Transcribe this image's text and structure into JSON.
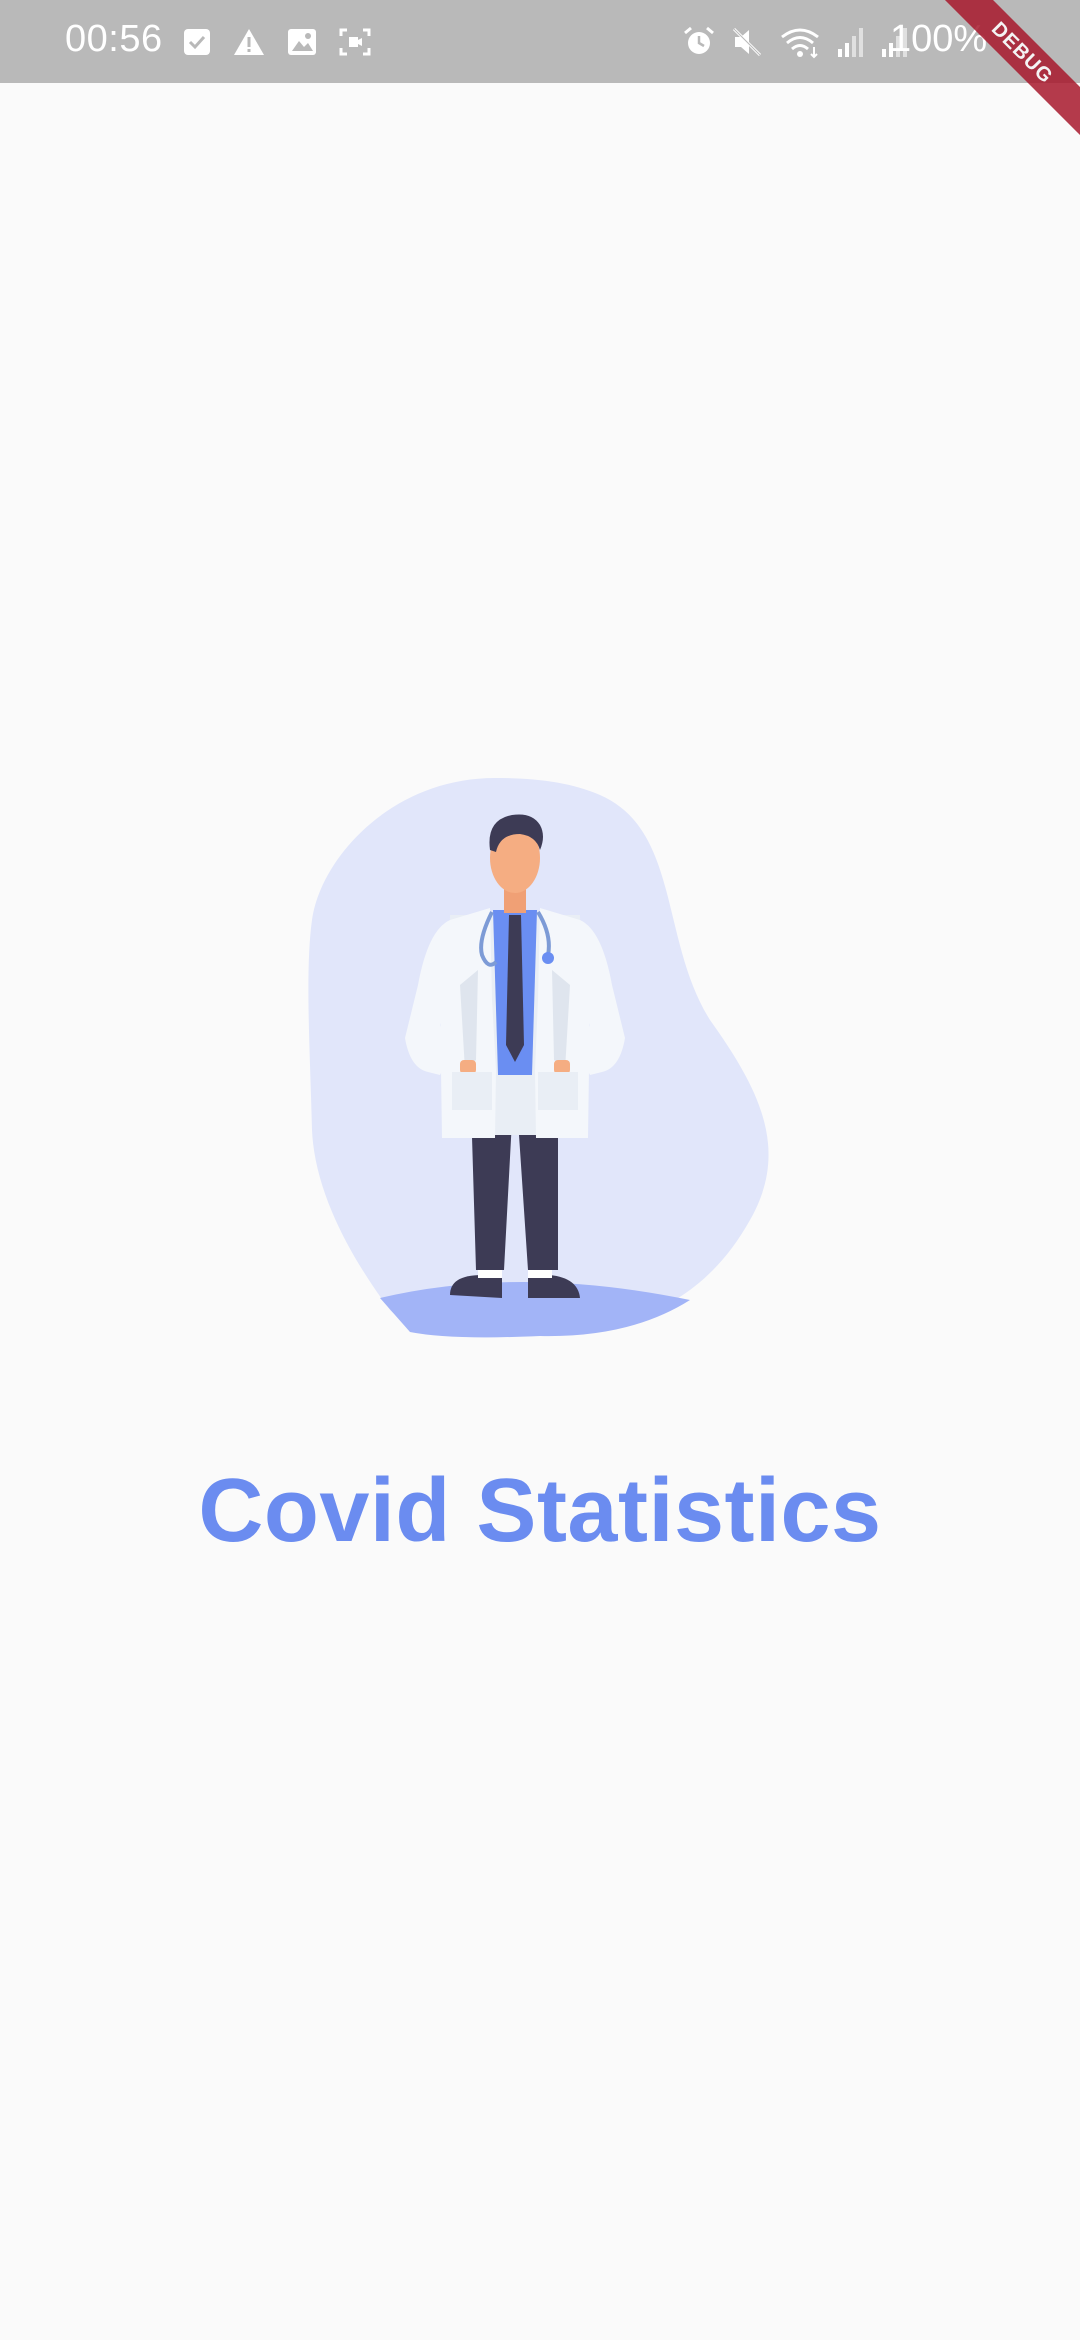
{
  "status_bar": {
    "time": "00:56",
    "left_icons": [
      "checkbox-icon",
      "warning-icon",
      "image-icon",
      "screen-record-icon"
    ],
    "right_icons": [
      "alarm-icon",
      "mute-icon",
      "wifi-icon",
      "signal-icon",
      "signal-icon"
    ],
    "battery": "100%"
  },
  "debug_banner": {
    "label": "DEBUG"
  },
  "main": {
    "illustration": "doctor-illustration",
    "title": "Covid Statistics"
  },
  "colors": {
    "accent": "#6b8cf0",
    "blob": "#e1e6fa",
    "background": "#fafafa",
    "status_bar": "#b9b9b9"
  }
}
